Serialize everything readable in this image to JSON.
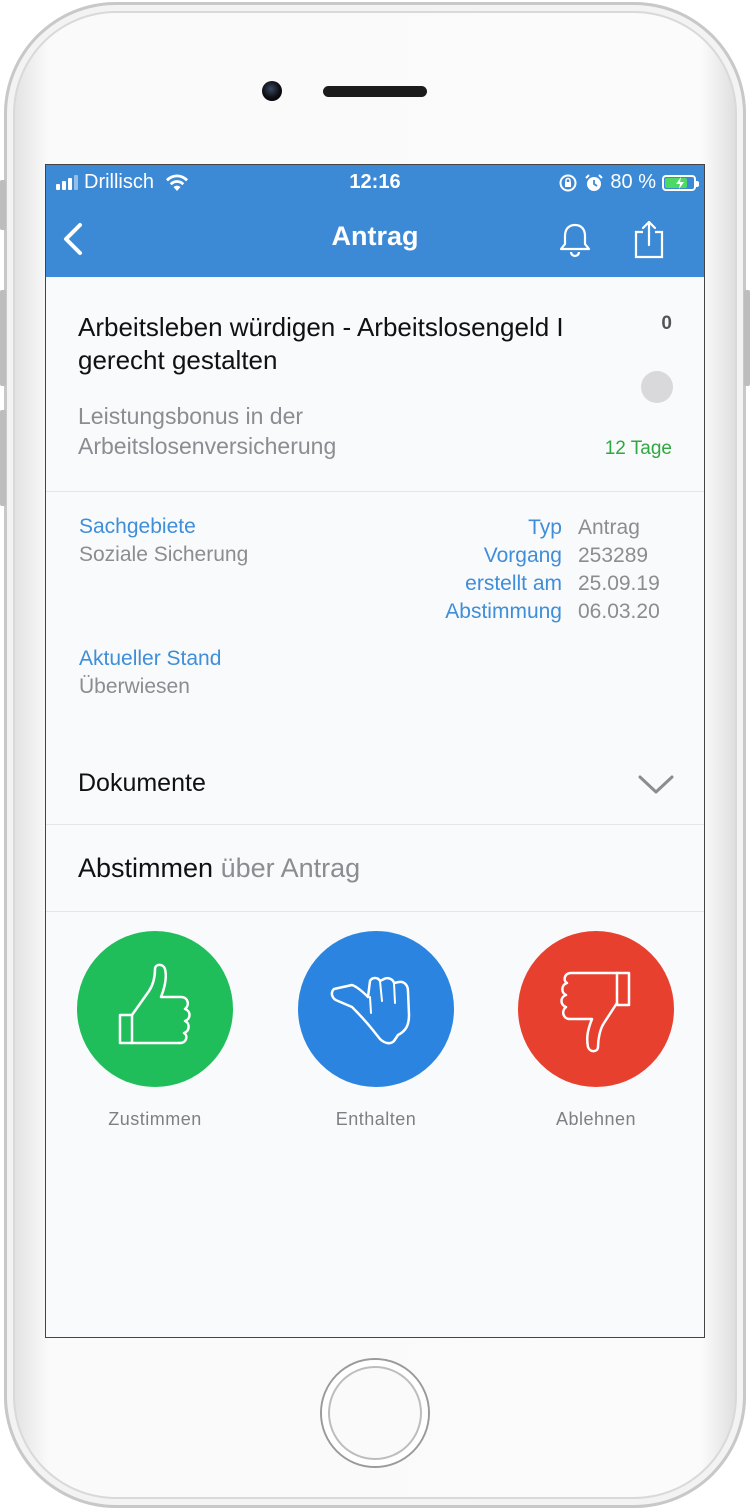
{
  "status_bar": {
    "carrier": "Drillisch",
    "time": "12:16",
    "battery_text": "80 %",
    "battery_level": 0.8
  },
  "nav": {
    "title": "Antrag"
  },
  "proposal": {
    "title": "Arbeitsleben würdigen - Arbeitslosengeld I gerecht gestalten",
    "count": "0",
    "subtitle": "Leistungsbonus in der Arbeitslosenversicherung",
    "days_left": "12 Tage"
  },
  "details": {
    "sachgebiete_label": "Sachgebiete",
    "sachgebiete_value": "Soziale Sicherung",
    "meta": [
      {
        "key": "Typ",
        "value": "Antrag"
      },
      {
        "key": "Vorgang",
        "value": "253289"
      },
      {
        "key": "erstellt am",
        "value": "25.09.19"
      },
      {
        "key": "Abstimmung",
        "value": "06.03.20"
      }
    ],
    "stand_label": "Aktueller Stand",
    "stand_value": "Überwiesen"
  },
  "documents": {
    "label": "Dokumente"
  },
  "vote": {
    "heading": "Abstimmen",
    "heading_sub": "über Antrag",
    "options": [
      {
        "label": "Zustimmen",
        "color": "#1fbe5a",
        "icon": "thumbs-up-icon"
      },
      {
        "label": "Enthalten",
        "color": "#2b84e0",
        "icon": "thumbs-sideways-icon"
      },
      {
        "label": "Ablehnen",
        "color": "#e8402f",
        "icon": "thumbs-down-icon"
      }
    ]
  },
  "colors": {
    "header_bg": "#3c8ad6",
    "label_blue": "#3f8ed9",
    "days_green": "#2fa842"
  }
}
